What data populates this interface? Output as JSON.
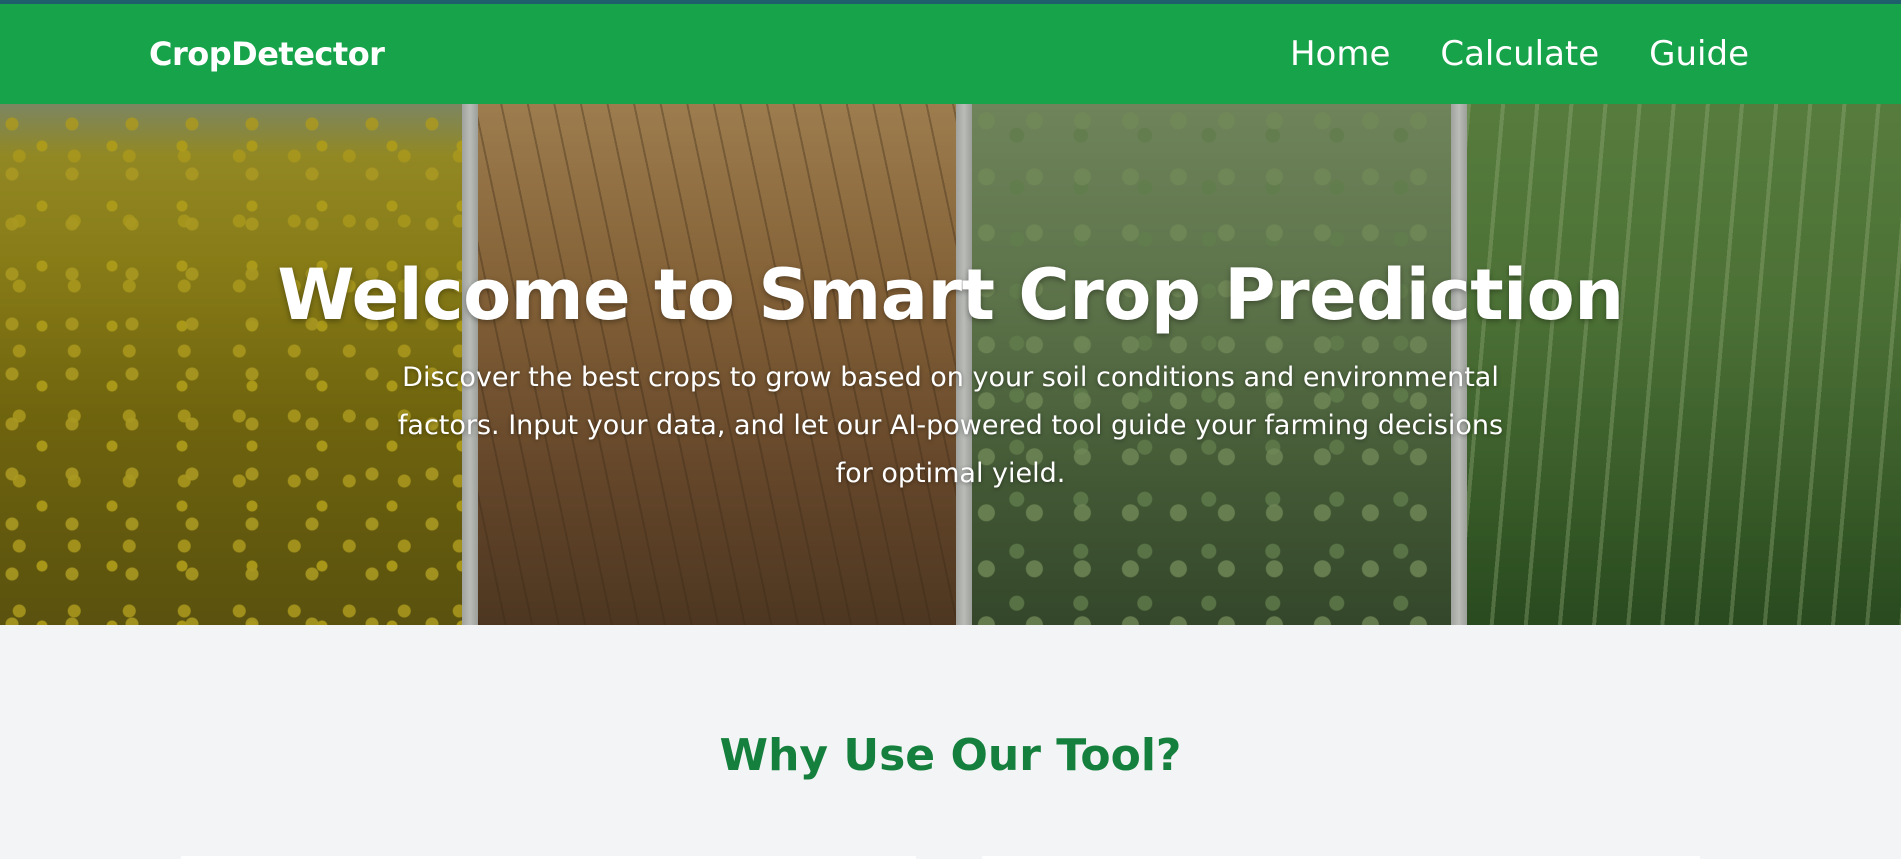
{
  "navbar": {
    "brand": "CropDetector",
    "links": [
      {
        "label": "Home"
      },
      {
        "label": "Calculate"
      },
      {
        "label": "Guide"
      }
    ],
    "background_color": "#16a34a",
    "accent_color": "#1e5f6b"
  },
  "hero": {
    "title": "Welcome to Smart Crop Prediction",
    "description": "Discover the best crops to grow based on your soil conditions and environmental factors. Input your data, and let our AI-powered tool guide your farming decisions for optimal yield."
  },
  "features": {
    "title": "Why Use Our Tool?",
    "title_color": "#15803d"
  }
}
